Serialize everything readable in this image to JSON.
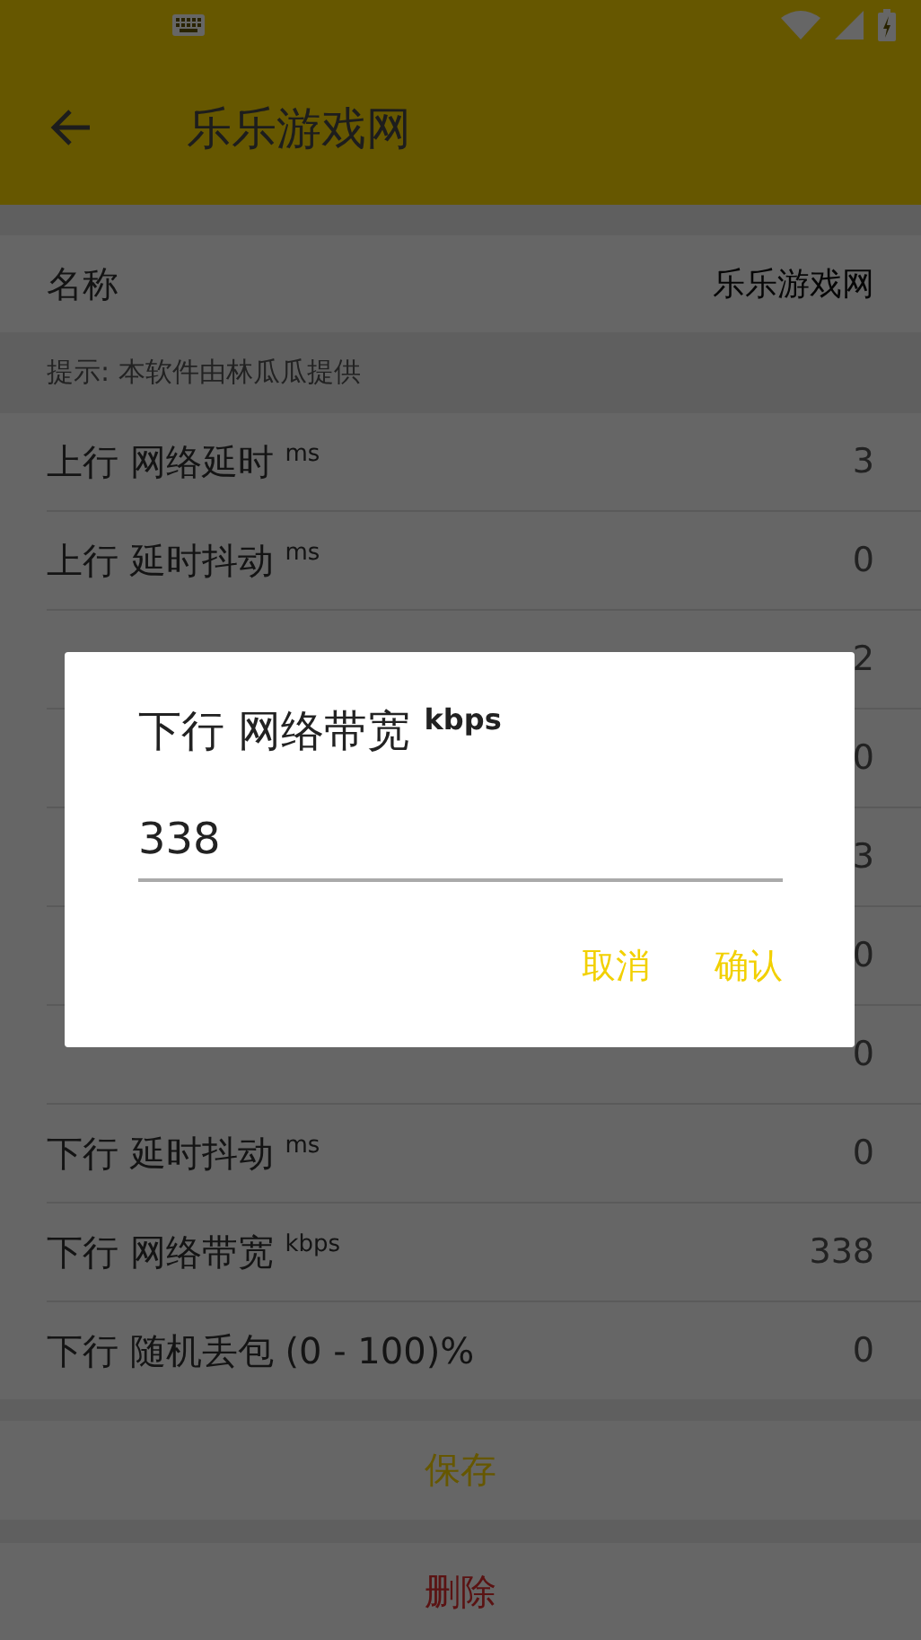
{
  "app_bar": {
    "title": "乐乐游戏网"
  },
  "name_row": {
    "label": "名称",
    "value": "乐乐游戏网"
  },
  "hint": "提示: 本软件由林瓜瓜提供",
  "rows": [
    {
      "label": "上行 网络延时 $^{ms}$",
      "value": "3"
    },
    {
      "label": "上行 延时抖动 $^{ms}$",
      "value": "0"
    },
    {
      "value": "2"
    },
    {
      "value": "0"
    },
    {
      "value": "3"
    },
    {
      "value": "0"
    },
    {
      "value": "0"
    },
    {
      "label": "下行 延时抖动 $^{ms}$",
      "value": "0"
    },
    {
      "label": "下行 网络带宽 $^{kbps}$",
      "value": "338"
    },
    {
      "label": "下行 随机丢包 (0 - 100)%",
      "value": "0"
    }
  ],
  "actions": [
    {
      "label": "保存",
      "kind": "save"
    },
    {
      "label": "删除",
      "kind": "delete"
    }
  ],
  "dialog": {
    "title": "下行 网络带宽 $^{kbps}$",
    "value": "338",
    "buttons": [
      "取消",
      "确认"
    ]
  }
}
